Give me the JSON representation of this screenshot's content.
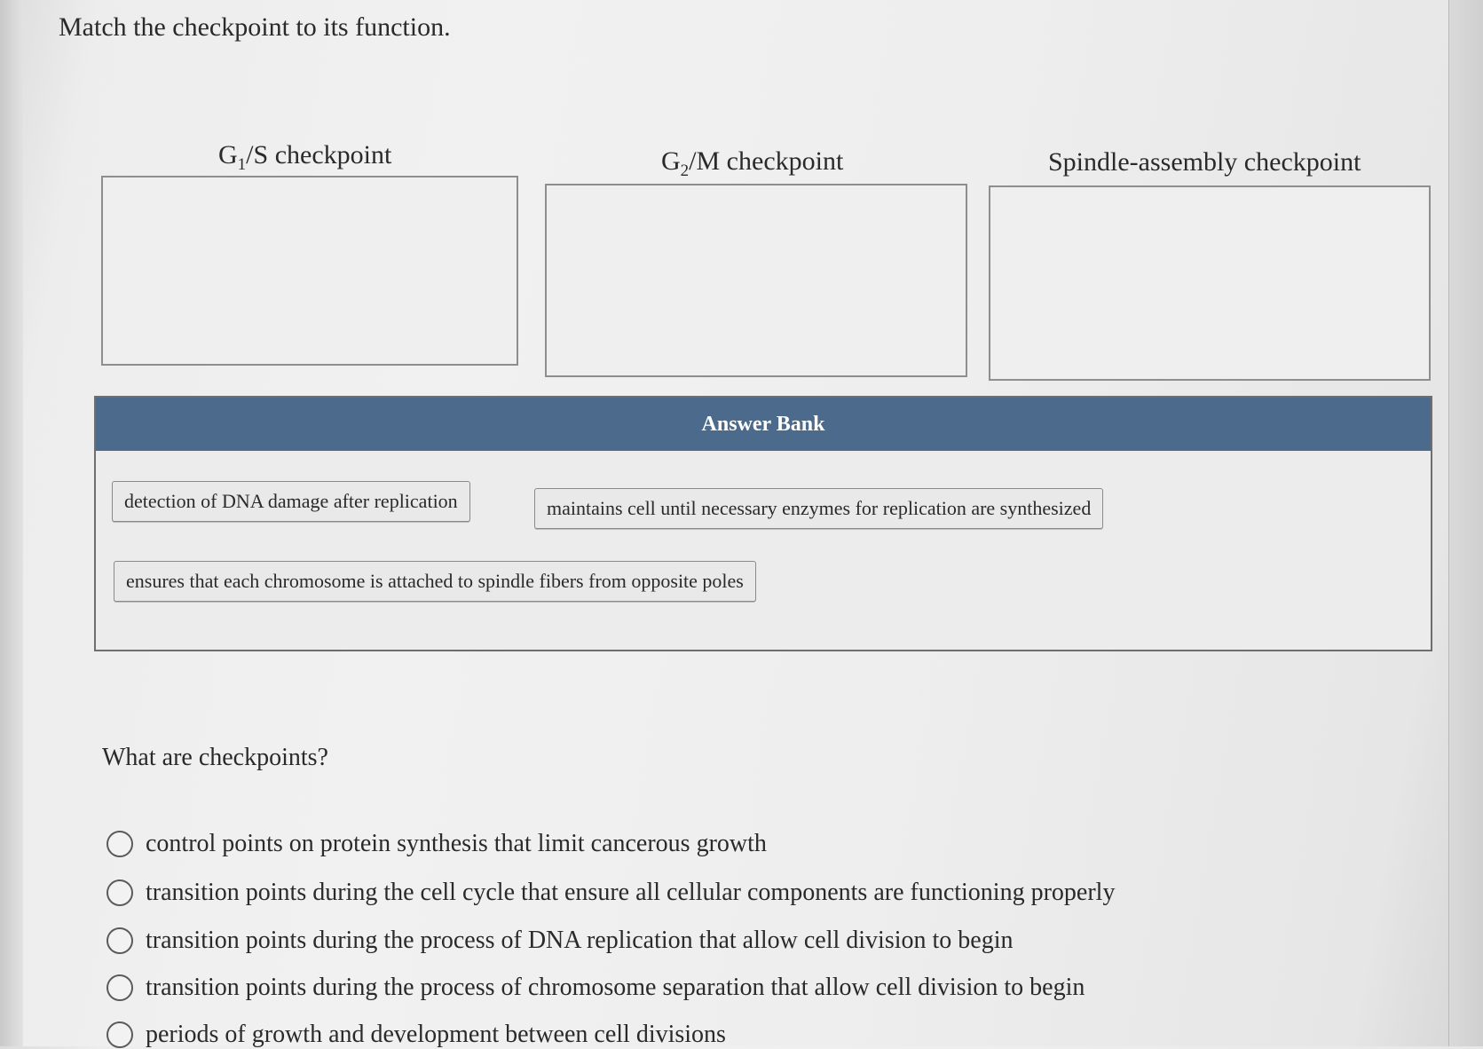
{
  "prompt": "Match the checkpoint to its function.",
  "targets": [
    {
      "label_main": "G",
      "label_sub": "1",
      "label_rest": "/S checkpoint"
    },
    {
      "label_main": "G",
      "label_sub": "2",
      "label_rest": "/M checkpoint"
    },
    {
      "label_main": "Spindle-assembly checkpoint",
      "label_sub": "",
      "label_rest": ""
    }
  ],
  "answer_bank": {
    "title": "Answer Bank",
    "items": [
      "detection of DNA damage after replication",
      "maintains cell until necessary enzymes for replication are synthesized",
      "ensures that each chromosome is attached to spindle fibers from opposite poles"
    ]
  },
  "question": {
    "text": "What are checkpoints?",
    "options": [
      "control points on protein synthesis that limit cancerous growth",
      "transition points during the cell cycle that ensure all cellular components are functioning properly",
      "transition points during the process of DNA replication that allow cell division to begin",
      "transition points during the process of chromosome separation that allow cell division to begin",
      "periods of growth and development between cell divisions"
    ]
  }
}
